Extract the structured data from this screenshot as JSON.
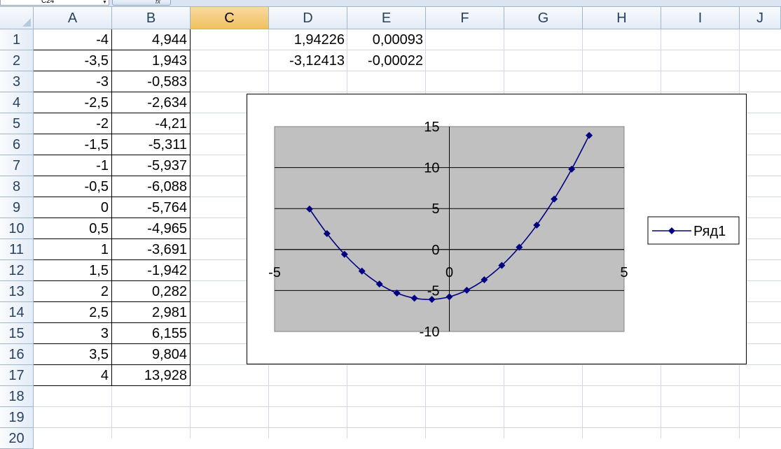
{
  "namebox": {
    "value": "C24"
  },
  "columns": [
    "A",
    "B",
    "C",
    "D",
    "E",
    "F",
    "G",
    "H",
    "I",
    "J"
  ],
  "selected_column": "C",
  "rows": [
    "1",
    "2",
    "3",
    "4",
    "5",
    "6",
    "7",
    "8",
    "9",
    "10",
    "11",
    "12",
    "13",
    "14",
    "15",
    "16",
    "17",
    "18",
    "19",
    "20"
  ],
  "table": {
    "A": [
      "-4",
      "-3,5",
      "-3",
      "-2,5",
      "-2",
      "-1,5",
      "-1",
      "-0,5",
      "0",
      "0,5",
      "1",
      "1,5",
      "2",
      "2,5",
      "3",
      "3,5",
      "4"
    ],
    "B": [
      "4,944",
      "1,943",
      "-0,583",
      "-2,634",
      "-4,21",
      "-5,311",
      "-5,937",
      "-6,088",
      "-5,764",
      "-4,965",
      "-3,691",
      "-1,942",
      "0,282",
      "2,981",
      "6,155",
      "9,804",
      "13,928"
    ]
  },
  "roots": {
    "D": [
      "1,94226",
      "-3,12413"
    ],
    "E": [
      "0,00093",
      "-0,00022"
    ]
  },
  "colors": {
    "series": "#000080",
    "plot_area": "#c0c0c0",
    "selected_header": "#f1c15f"
  },
  "chart_data": {
    "type": "scatter",
    "x": [
      -4,
      -3.5,
      -3,
      -2.5,
      -2,
      -1.5,
      -1,
      -0.5,
      0,
      0.5,
      1,
      1.5,
      2,
      2.5,
      3,
      3.5,
      4
    ],
    "series": [
      {
        "name": "Ряд1",
        "values": [
          4.944,
          1.943,
          -0.583,
          -2.634,
          -4.21,
          -5.311,
          -5.937,
          -6.088,
          -5.764,
          -4.965,
          -3.691,
          -1.942,
          0.282,
          2.981,
          6.155,
          9.804,
          13.928
        ]
      }
    ],
    "xlim": [
      -5,
      5
    ],
    "ylim": [
      -10,
      15
    ],
    "x_ticks": [
      "-5",
      "0",
      "5"
    ],
    "y_ticks": [
      "-10",
      "-5",
      "0",
      "5",
      "10",
      "15"
    ],
    "grid": true,
    "legend": "right",
    "smoothed": true,
    "marker": "diamond"
  }
}
